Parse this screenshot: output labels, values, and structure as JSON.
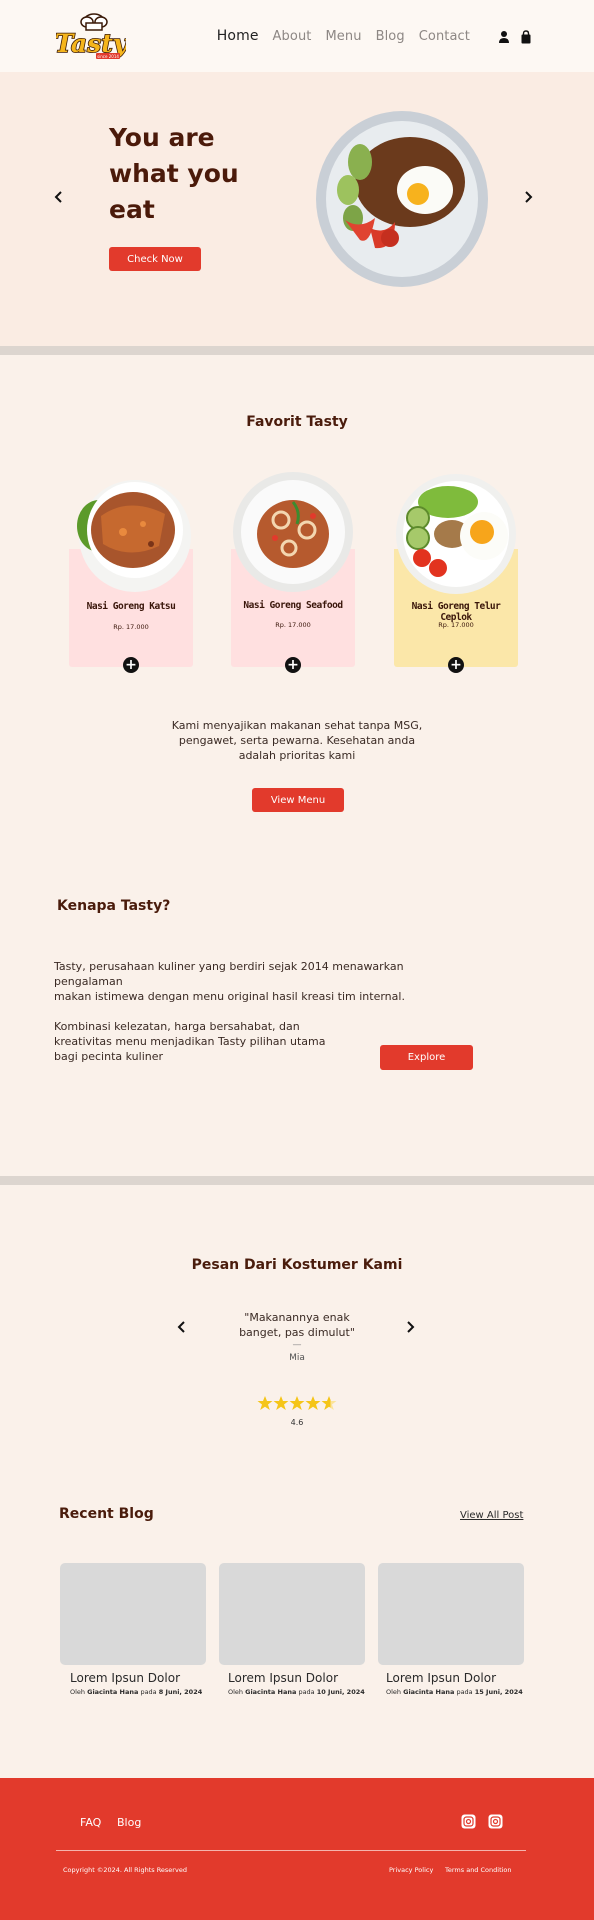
{
  "header": {
    "logo_text": "Tasty",
    "logo_subtext": "since 2014",
    "nav": [
      "Home",
      "About",
      "Menu",
      "Blog",
      "Contact"
    ],
    "icons": [
      "user-icon",
      "shopping-bag-icon"
    ]
  },
  "hero": {
    "title_line1": "You are",
    "title_line2": "what you",
    "title_line3": "eat",
    "cta_label": "Check Now"
  },
  "favorites": {
    "title": "Favorit Tasty",
    "items": [
      {
        "name": "Nasi Goreng Katsu",
        "price": "Rp. 17.000",
        "card_color": "#ffe0e0"
      },
      {
        "name": "Nasi Goreng Seafood",
        "price": "Rp. 17.000",
        "card_color": "#ffe0e0"
      },
      {
        "name": "Nasi Goreng Telur Ceplok",
        "price": "Rp. 17.000",
        "card_color": "#fbe7a9"
      }
    ],
    "desc_line1": "Kami menyajikan makanan sehat tanpa MSG,",
    "desc_line2": "pengawet, serta pewarna. Kesehatan anda",
    "desc_line3": "adalah prioritas kami",
    "view_menu_label": "View Menu"
  },
  "why": {
    "title": "Kenapa Tasty?",
    "para1_line1": "Tasty, perusahaan kuliner yang berdiri sejak 2014 menawarkan pengalaman",
    "para1_line2": "makan istimewa dengan menu original hasil kreasi tim internal.",
    "para2_line1": "Kombinasi kelezatan, harga bersahabat, dan",
    "para2_line2": "kreativitas menu menjadikan Tasty pilihan utama",
    "para2_line3": "bagi pecinta kuliner",
    "explore_label": "Explore"
  },
  "testimonials": {
    "title": "Pesan Dari Kostumer Kami",
    "quote_line1": "\"Makanannya enak",
    "quote_line2": "banget, pas dimulut\"",
    "dash": "—",
    "author": "Mia",
    "rating": 4.6,
    "rating_label": "4.6"
  },
  "blog": {
    "title": "Recent Blog",
    "view_all_label": "View All Post",
    "posts": [
      {
        "title": "Lorem Ipsun Dolor",
        "meta_prefix": "Oleh ",
        "author": "Giacinta Hana",
        "meta_mid": " pada ",
        "date": "8 Juni, 2024"
      },
      {
        "title": "Lorem Ipsun Dolor",
        "meta_prefix": "Oleh ",
        "author": "Giacinta Hana",
        "meta_mid": " pada ",
        "date": "10 Juni, 2024"
      },
      {
        "title": "Lorem Ipsun Dolor",
        "meta_prefix": "Oleh ",
        "author": "Giacinta Hana",
        "meta_mid": " pada ",
        "date": "15 Juni, 2024"
      }
    ]
  },
  "footer": {
    "links": [
      "FAQ",
      "Blog"
    ],
    "social_icons": [
      "instagram-icon",
      "instagram-icon"
    ],
    "copyright": "Copyright ©2024. All Rights Reserved",
    "privacy": "Privacy Policy",
    "terms": "Terms and Condition",
    "background": "#e23a2c"
  },
  "colors": {
    "accent": "#e23a2c",
    "heading": "#4a1c0c",
    "page_bg": "#faf1ea",
    "star": "#f5c518"
  }
}
